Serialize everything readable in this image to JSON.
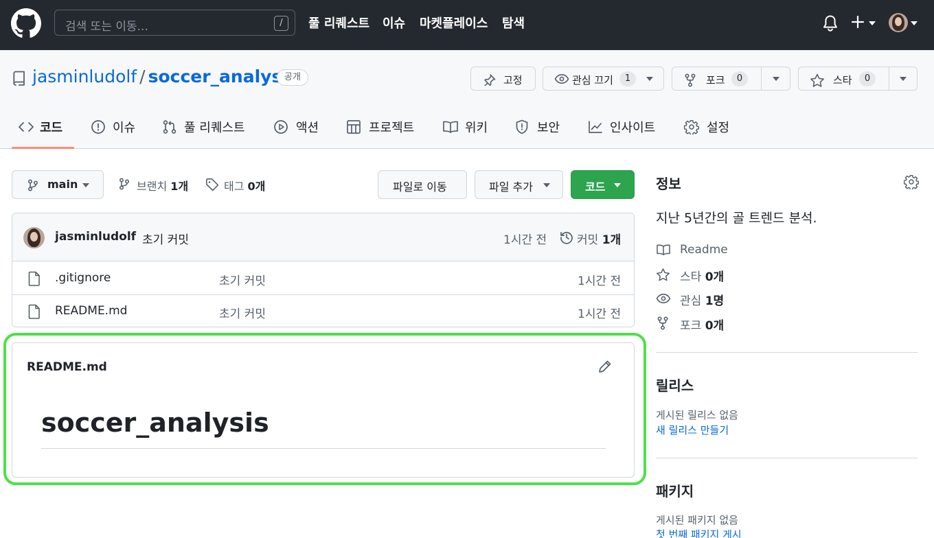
{
  "header": {
    "search_placeholder": "검색 또는 이동...",
    "search_shortcut": "/",
    "nav": [
      "풀 리퀘스트",
      "이슈",
      "마켓플레이스",
      "탐색"
    ]
  },
  "repo": {
    "owner": "jasminludolf",
    "separator": "/",
    "name": "soccer_analysis",
    "visibility": "공개",
    "buttons": {
      "pin_label": "고정",
      "watch_label": "관심 끄기",
      "watch_count": "1",
      "fork_label": "포크",
      "fork_count": "0",
      "star_label": "스타",
      "star_count": "0"
    },
    "tabs": [
      "코드",
      "이슈",
      "풀 리퀘스트",
      "액션",
      "프로젝트",
      "위키",
      "보안",
      "인사이트",
      "설정"
    ]
  },
  "branch_bar": {
    "branch": "main",
    "branches_label": "브랜치",
    "branches_count": "1개",
    "tags_label": "태그",
    "tags_count": "0개",
    "goto_file": "파일로 이동",
    "add_file": "파일 추가",
    "code_button": "코드"
  },
  "latest_commit": {
    "author": "jasminludolf",
    "message": "초기 커밋",
    "time": "1시간 전",
    "commits_label": "커밋",
    "commits_count": "1개"
  },
  "files": [
    {
      "name": ".gitignore",
      "message": "초기 커밋",
      "time": "1시간 전"
    },
    {
      "name": "README.md",
      "message": "초기 커밋",
      "time": "1시간 전"
    }
  ],
  "readme": {
    "filename": "README.md",
    "heading": "soccer_analysis",
    "highlight_color": "#4ee048"
  },
  "sidebar": {
    "about_title": "정보",
    "description": "지난 5년간의 골 트렌드 분석.",
    "items": {
      "readme": "Readme",
      "stars_label": "스타",
      "stars_count": "0개",
      "watchers_label": "관심",
      "watchers_count": "1명",
      "forks_label": "포크",
      "forks_count": "0개"
    },
    "releases_title": "릴리스",
    "releases_empty": "게시된 릴리스 없음",
    "releases_link": "새 릴리스 만들기",
    "packages_title": "패키지",
    "packages_empty": "게시된 패키지 없음",
    "packages_link": "첫 번째 패키지 게시"
  },
  "colors": {
    "header_bg": "#24292f",
    "link": "#0969da",
    "primary_button": "#2da44e",
    "active_tab_underline": "#fd8c73"
  }
}
